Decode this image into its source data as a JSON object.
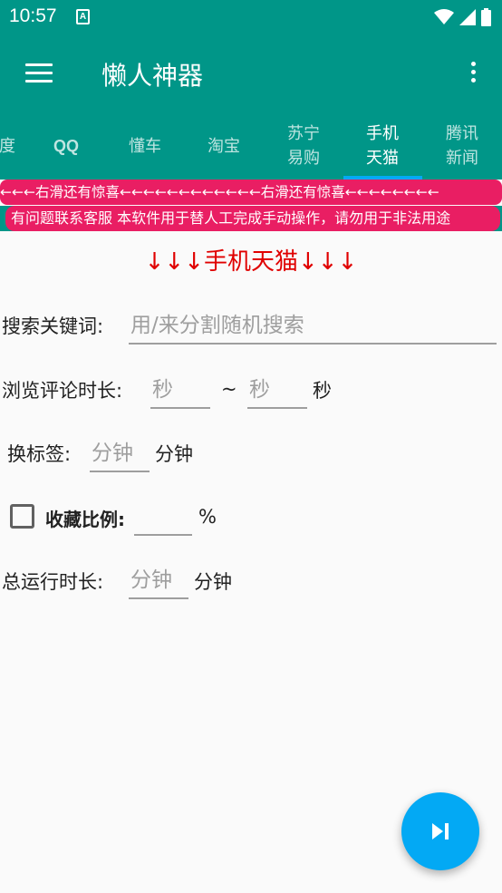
{
  "status_bar": {
    "time": "10:57",
    "notification_icon": "android-a-icon",
    "icons": [
      "wifi-icon",
      "signal-icon",
      "battery-icon"
    ]
  },
  "app_bar": {
    "title": "懒人神器",
    "menu_icon": "hamburger-menu-icon",
    "more_icon": "more-vert-icon"
  },
  "tabs": [
    {
      "label": "度",
      "active": false
    },
    {
      "label": "QQ",
      "active": false
    },
    {
      "label": "懂车",
      "active": false
    },
    {
      "label": "淘宝",
      "active": false
    },
    {
      "label": "苏宁\n易购",
      "active": false
    },
    {
      "label": "手机\n天猫",
      "active": true
    },
    {
      "label": "腾讯\n新闻",
      "active": false
    }
  ],
  "marquee_text": "←←←右滑还有惊喜←←←←←←←←←←←←右滑还有惊喜←←←←←←←←",
  "notice_text": "有问题联系客服 本软件用于替人工完成手动操作，请勿用于非法用途",
  "section_title": "↓↓↓手机天猫↓↓↓",
  "form": {
    "search_label": "搜索关键词:",
    "search_placeholder": "用/来分割随机搜索",
    "browse_label": "浏览评论时长:",
    "browse_min_placeholder": "秒",
    "range_separator": "~",
    "browse_max_placeholder": "秒",
    "browse_unit": "秒",
    "switch_tab_label": "换标签:",
    "switch_tab_placeholder": "分钟",
    "switch_tab_unit": "分钟",
    "favorite_label": "收藏比例:",
    "favorite_checked": false,
    "favorite_value": "",
    "favorite_unit": "%",
    "total_label": "总运行时长:",
    "total_placeholder": "分钟",
    "total_unit": "分钟"
  },
  "fab_icon": "skip-next-icon",
  "colors": {
    "primary": "#009688",
    "accent": "#03a9f4",
    "banner": "#e91e63",
    "title_red": "#e00000"
  }
}
